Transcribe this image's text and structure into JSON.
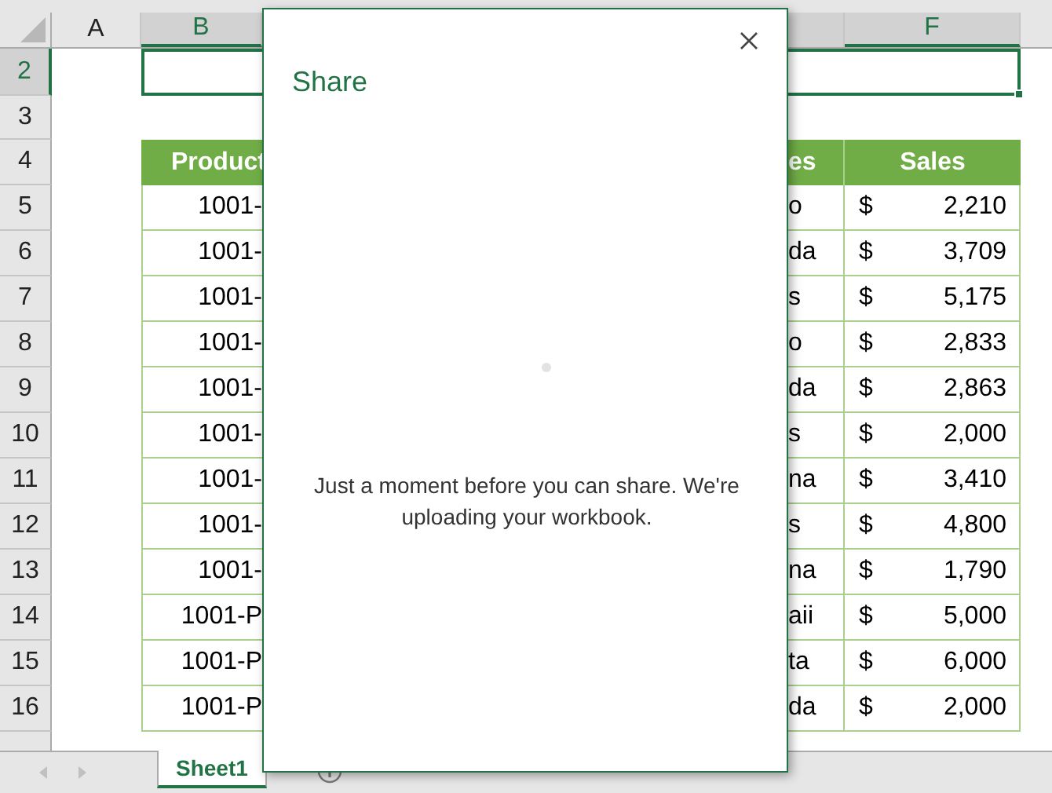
{
  "columns": [
    {
      "label": "A",
      "selected": false
    },
    {
      "label": "B",
      "selected": true
    },
    {
      "label": "F",
      "selected": true
    }
  ],
  "row_numbers": [
    {
      "label": "2",
      "selected": true
    },
    {
      "label": "3",
      "selected": false
    },
    {
      "label": "4",
      "selected": false
    },
    {
      "label": "5",
      "selected": false
    },
    {
      "label": "6",
      "selected": false
    },
    {
      "label": "7",
      "selected": false
    },
    {
      "label": "8",
      "selected": false
    },
    {
      "label": "9",
      "selected": false
    },
    {
      "label": "10",
      "selected": false
    },
    {
      "label": "11",
      "selected": false
    },
    {
      "label": "12",
      "selected": false
    },
    {
      "label": "13",
      "selected": false
    },
    {
      "label": "14",
      "selected": false
    },
    {
      "label": "15",
      "selected": false
    },
    {
      "label": "16",
      "selected": false
    }
  ],
  "table": {
    "headers": [
      "Product",
      "es",
      "Sales"
    ],
    "rows": [
      {
        "product": "1001-",
        "column_2": "o",
        "currency": "$",
        "sales": "2,210"
      },
      {
        "product": "1001-",
        "column_2": "da",
        "currency": "$",
        "sales": "3,709"
      },
      {
        "product": "1001-",
        "column_2": "s",
        "currency": "$",
        "sales": "5,175"
      },
      {
        "product": "1001-",
        "column_2": "o",
        "currency": "$",
        "sales": "2,833"
      },
      {
        "product": "1001-",
        "column_2": "da",
        "currency": "$",
        "sales": "2,863"
      },
      {
        "product": "1001-",
        "column_2": "s",
        "currency": "$",
        "sales": "2,000"
      },
      {
        "product": "1001-",
        "column_2": "na",
        "currency": "$",
        "sales": "3,410"
      },
      {
        "product": "1001-",
        "column_2": "s",
        "currency": "$",
        "sales": "4,800"
      },
      {
        "product": "1001-",
        "column_2": "na",
        "currency": "$",
        "sales": "1,790"
      },
      {
        "product": "1001-P",
        "column_2": "aii",
        "currency": "$",
        "sales": "5,000"
      },
      {
        "product": "1001-P",
        "column_2": "ta",
        "currency": "$",
        "sales": "6,000"
      },
      {
        "product": "1001-P",
        "column_2": "da",
        "currency": "$",
        "sales": "2,000"
      }
    ]
  },
  "sheet_tabs": [
    {
      "label": "Sheet1",
      "selected": true
    }
  ],
  "dialog": {
    "title": "Share",
    "message": "Just a moment before you can share. We're uploading your workbook."
  }
}
